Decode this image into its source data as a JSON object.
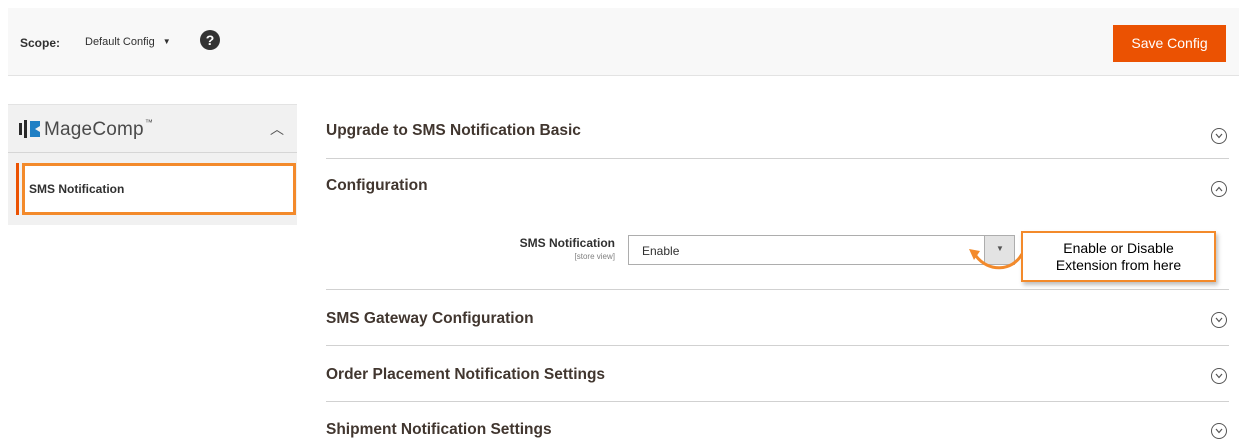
{
  "scope": {
    "label": "Scope:",
    "value": "Default Config",
    "help_icon": "question-circle-icon"
  },
  "toolbar": {
    "save_label": "Save Config",
    "accent": "#eb5202"
  },
  "sidebar": {
    "brand": "MageComp",
    "brand_tm": "™",
    "items": [
      {
        "label": "SMS Notification",
        "active": true
      }
    ]
  },
  "sections": [
    {
      "title": "Upgrade to SMS Notification Basic",
      "expanded": false
    },
    {
      "title": "Configuration",
      "expanded": true
    },
    {
      "title": "SMS Gateway Configuration",
      "expanded": false
    },
    {
      "title": "Order Placement Notification Settings",
      "expanded": false
    },
    {
      "title": "Shipment Notification Settings",
      "expanded": false
    }
  ],
  "config": {
    "field_label": "SMS Notification",
    "field_scope": "[store view]",
    "field_value": "Enable"
  },
  "callout": {
    "line1": "Enable or Disable",
    "line2": "Extension from here",
    "border_color": "#f38a2b"
  }
}
